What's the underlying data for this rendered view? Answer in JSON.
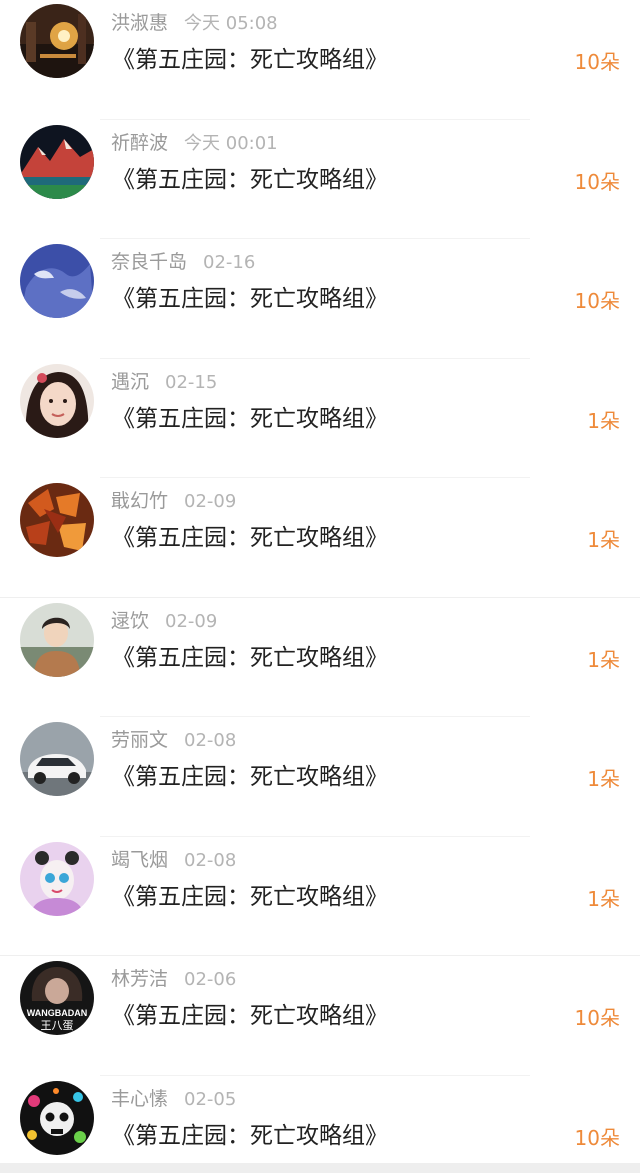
{
  "items": [
    {
      "name": "洪淑惠",
      "time": "今天 05:08",
      "title": "《第五庄园：死亡攻略组》",
      "count": "10朵",
      "avatar": "night-cityscape-avatar"
    },
    {
      "name": "祈醉波",
      "time": "今天 00:01",
      "title": "《第五庄园：死亡攻略组》",
      "count": "10朵",
      "avatar": "mountain-landscape-avatar"
    },
    {
      "name": "奈良千岛",
      "time": "02-16",
      "title": "《第五庄园：死亡攻略组》",
      "count": "10朵",
      "avatar": "blue-illustration-avatar"
    },
    {
      "name": "遇沉",
      "time": "02-15",
      "title": "《第五庄园：死亡攻略组》",
      "count": "1朵",
      "avatar": "girl-portrait-avatar"
    },
    {
      "name": "戢幻竹",
      "time": "02-09",
      "title": "《第五庄园：死亡攻略组》",
      "count": "1朵",
      "avatar": "autumn-leaves-avatar"
    },
    {
      "name": "逯饮",
      "time": "02-09",
      "title": "《第五庄园：死亡攻略组》",
      "count": "1朵",
      "avatar": "man-portrait-avatar"
    },
    {
      "name": "劳丽文",
      "time": "02-08",
      "title": "《第五庄园：死亡攻略组》",
      "count": "1朵",
      "avatar": "white-car-avatar"
    },
    {
      "name": "竭飞烟",
      "time": "02-08",
      "title": "《第五庄园：死亡攻略组》",
      "count": "1朵",
      "avatar": "cartoon-girl-avatar"
    },
    {
      "name": "林芳洁",
      "time": "02-06",
      "title": "《第五庄园：死亡攻略组》",
      "count": "10朵",
      "avatar": "wangbadan-avatar",
      "avatar_text": [
        "WANGBADAN",
        "王八蛋"
      ]
    },
    {
      "name": "丰心愫",
      "time": "02-05",
      "title": "《第五庄园：死亡攻略组》",
      "count": "10朵",
      "avatar": "colorful-skull-avatar"
    }
  ]
}
